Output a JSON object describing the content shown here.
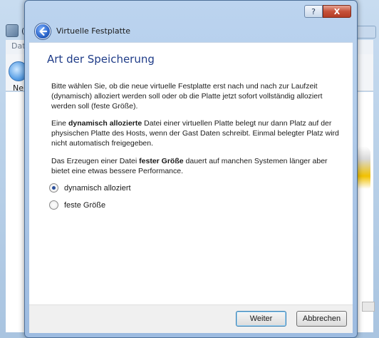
{
  "background_window": {
    "title_fragment": "(",
    "menu_fragment": "Dat",
    "toolbar_new_label": "Neu"
  },
  "dialog": {
    "title": "Virtuelle Festplatte",
    "help_button": "?",
    "close_button": "X",
    "back_icon": "back-arrow-icon",
    "heading": "Art der Speicherung",
    "paragraph1": "Bitte wählen Sie, ob die neue virtuelle Festplatte erst nach und nach zur Laufzeit (dynamisch) alloziert werden soll oder ob die Platte jetzt sofort vollständig alloziert werden soll (feste Größe).",
    "paragraph2": {
      "before": "Eine ",
      "bold": "dynamisch allozierte",
      "after": " Datei einer virtuellen Platte belegt nur dann Platz auf der physischen Platte des Hosts, wenn der Gast Daten schreibt. Einmal belegter Platz wird nicht automatisch freigegeben."
    },
    "paragraph3": {
      "before": "Das Erzeugen einer Datei ",
      "bold": "fester Größe",
      "after": " dauert auf manchen Systemen länger aber bietet eine etwas bessere Performance."
    },
    "options": [
      {
        "label": "dynamisch alloziert",
        "selected": true
      },
      {
        "label": "feste Größe",
        "selected": false
      }
    ],
    "buttons": {
      "next": "Weiter",
      "cancel": "Abbrechen"
    }
  },
  "colors": {
    "heading": "#1f3c88",
    "accent": "#2a63c8"
  }
}
